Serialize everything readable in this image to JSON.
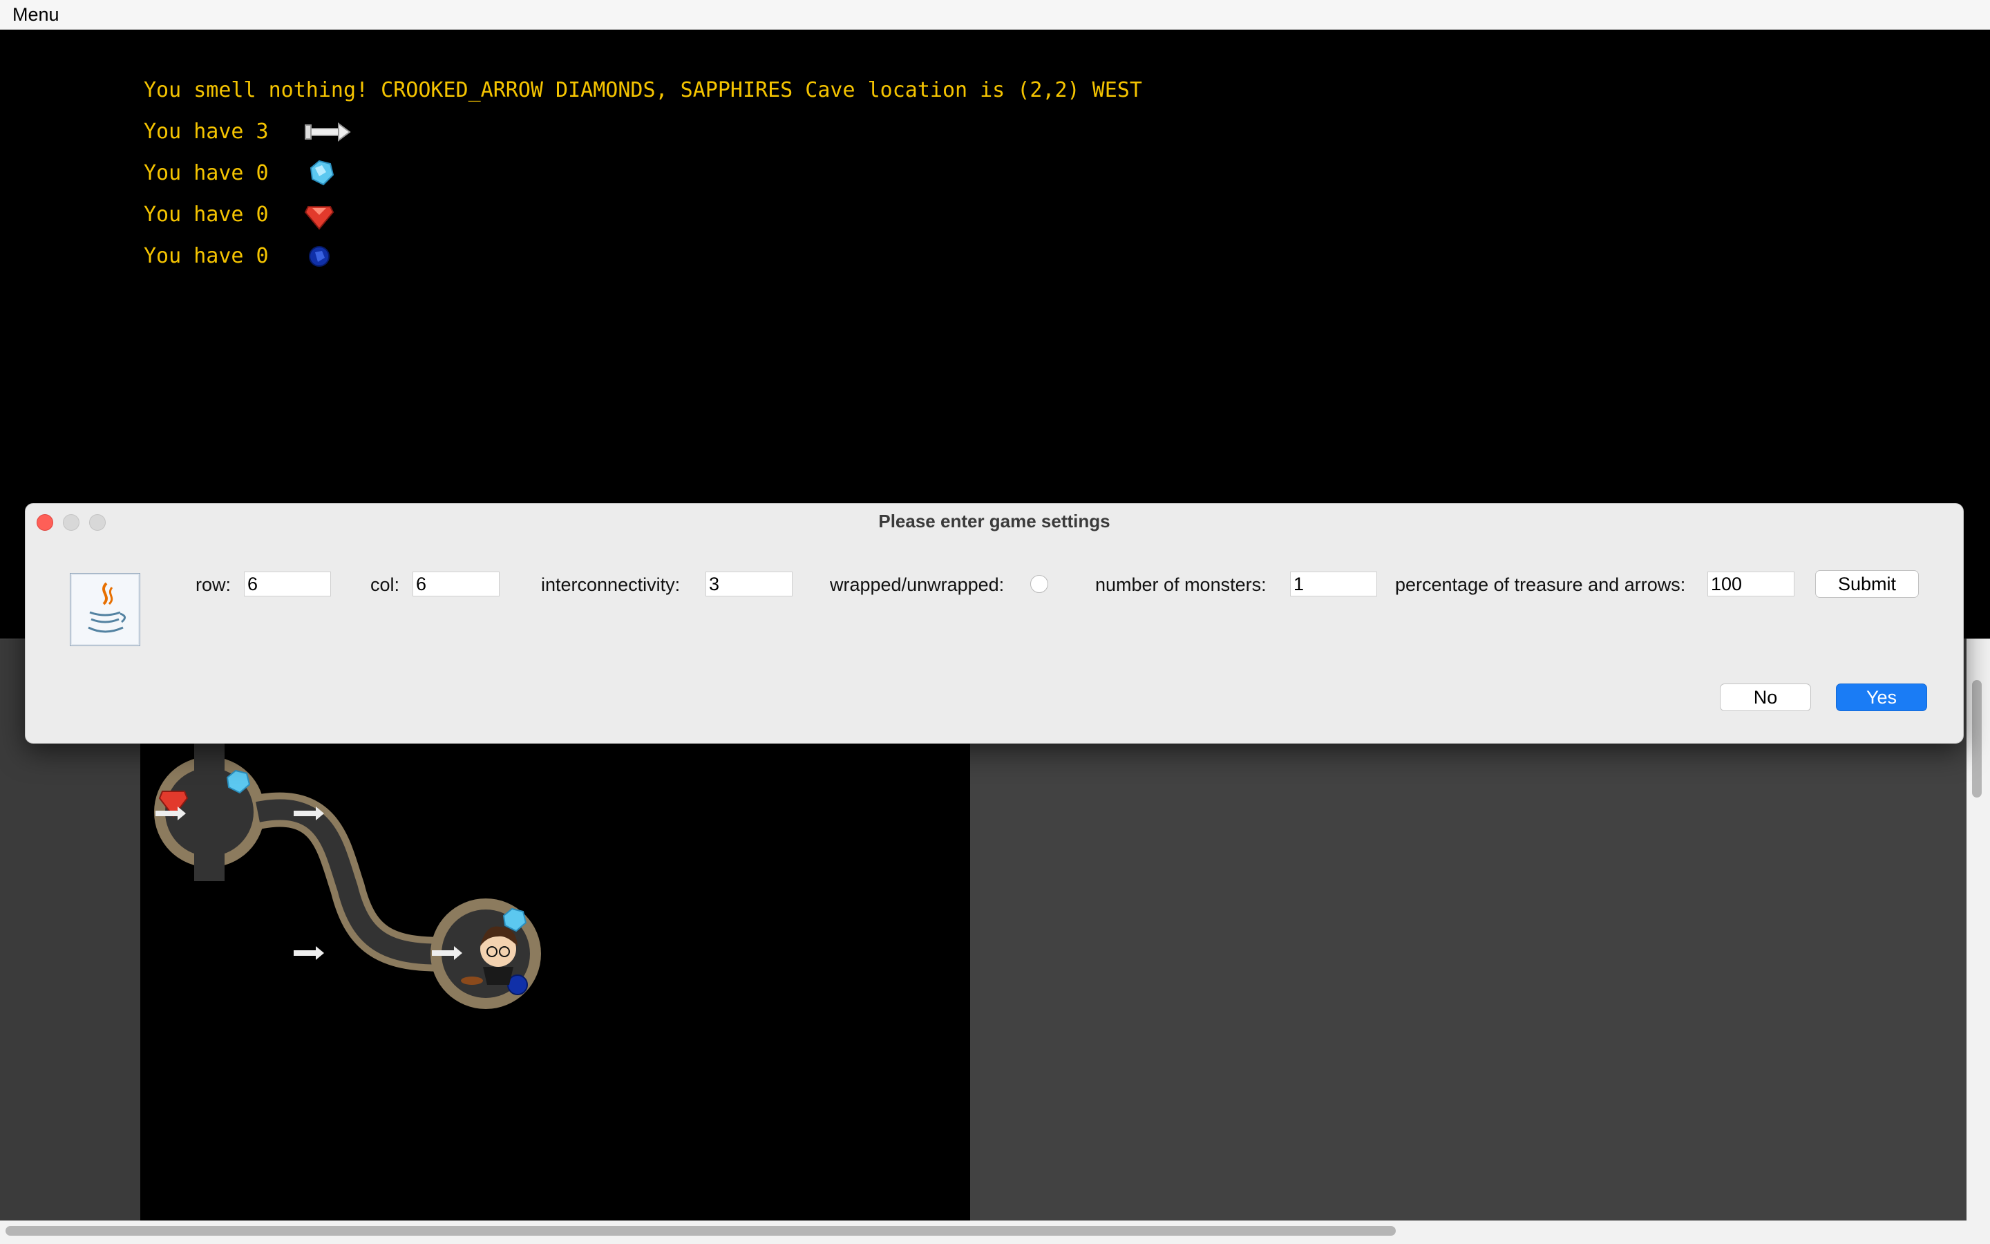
{
  "menubar": {
    "menu_label": "Menu"
  },
  "status": {
    "message": "You smell nothing! CROOKED_ARROW DIAMONDS, SAPPHIRES Cave location is (2,2) WEST",
    "inventory": [
      {
        "text": "You have 3",
        "icon": "arrow-icon"
      },
      {
        "text": "You have 0",
        "icon": "diamond-icon"
      },
      {
        "text": "You have 0",
        "icon": "ruby-icon"
      },
      {
        "text": "You have 0",
        "icon": "sapphire-icon"
      }
    ]
  },
  "dialog": {
    "title": "Please enter game settings",
    "fields": {
      "row_label": "row:",
      "row_value": "6",
      "col_label": "col:",
      "col_value": "6",
      "interconnectivity_label": "interconnectivity:",
      "interconnectivity_value": "3",
      "wrapped_label": "wrapped/unwrapped:",
      "monsters_label": "number of monsters:",
      "monsters_value": "1",
      "percentage_label": "percentage of treasure and arrows:",
      "percentage_value": "100"
    },
    "submit_label": "Submit",
    "no_label": "No",
    "yes_label": "Yes"
  },
  "colors": {
    "status_text": "#f5c400",
    "primary_button": "#1a7cf5",
    "close_button": "#fe5f57"
  }
}
